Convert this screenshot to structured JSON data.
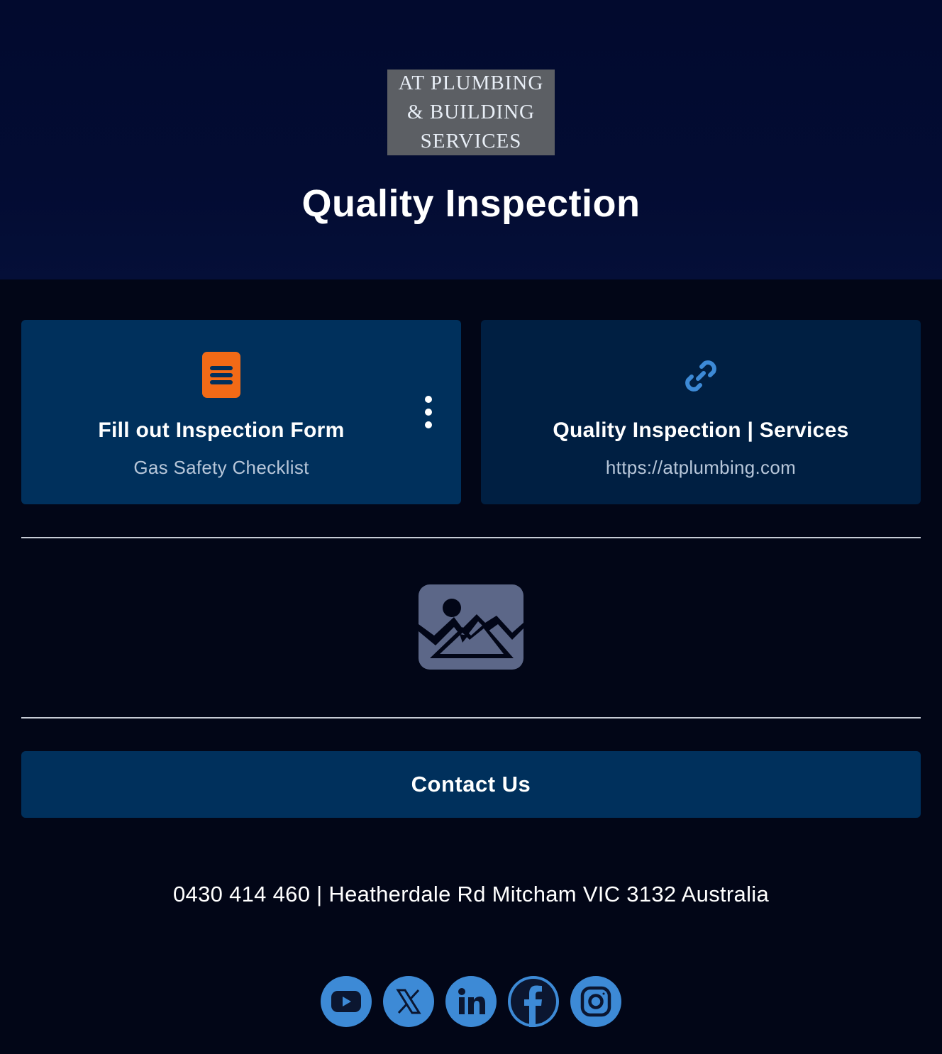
{
  "logo": {
    "line1": "AT PLUMBING",
    "line2": "& BUILDING",
    "line3": "SERVICES"
  },
  "page_title": "Quality Inspection",
  "cards": [
    {
      "title": "Fill out Inspection Form",
      "subtitle": "Gas Safety Checklist",
      "icon": "form-document-icon",
      "icon_color": "#f26a16"
    },
    {
      "title": "Quality Inspection | Services",
      "subtitle": "https://atplumbing.com",
      "icon": "link-icon",
      "icon_color": "#3d8ad6"
    }
  ],
  "image_placeholder_icon": "image-icon",
  "contact_button": "Contact Us",
  "footer": {
    "contact_line": "0430 414 460 | Heatherdale Rd Mitcham VIC 3132 Australia"
  },
  "social": [
    "youtube-icon",
    "x-icon",
    "linkedin-icon",
    "facebook-icon",
    "instagram-icon"
  ],
  "colors": {
    "background": "#020617",
    "header": "#020a2e",
    "card_primary": "#00305c",
    "card_secondary": "#001f42",
    "accent_orange": "#f26a16",
    "social_blue": "#3d8ad6",
    "placeholder_gray": "#5c6788"
  }
}
